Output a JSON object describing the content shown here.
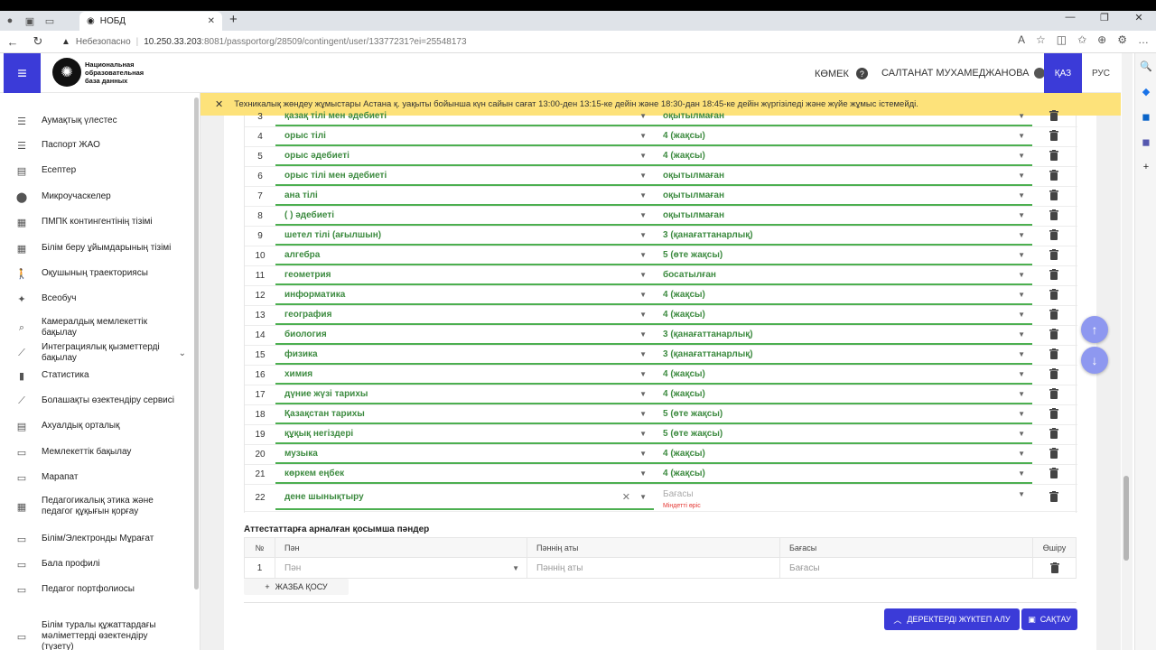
{
  "browser": {
    "tab_title": "НОБД",
    "insecure_label": "Небезопасно",
    "url_host": "10.250.33.203",
    "url_rest": ":8081/passportorg/28509/contingent/user/13377231?ei=25548173"
  },
  "header": {
    "logo_text": "Национальная образовательная база данных",
    "help_label": "КӨМЕК",
    "user_name": "САЛТАНАТ МУХАМЕДЖАНОВА",
    "lang_kz": "ҚАЗ",
    "lang_ru": "РУС"
  },
  "notice": {
    "text": "Техникалық жөндеу жұмыстары Астана қ. уақыты бойынша күн сайын сағат 13:00-ден 13:15-ке дейін және 18:30-дан 18:45-ке дейін жүргізіледі және жүйе жұмыс істемейді."
  },
  "sidebar": {
    "items": [
      {
        "label": "Аумақтық үлестес",
        "icon": "list-icon"
      },
      {
        "label": "Паспорт ЖАО",
        "icon": "list-icon"
      },
      {
        "label": "Есептер",
        "icon": "clipboard-icon"
      },
      {
        "label": "Микроучаскелер",
        "icon": "pin-icon"
      },
      {
        "label": "ПМПК контингентінің тізімі",
        "icon": "table-icon"
      },
      {
        "label": "Білім беру ұйымдарының тізімі",
        "icon": "table-icon"
      },
      {
        "label": "Оқушының траекториясы",
        "icon": "walk-icon"
      },
      {
        "label": "Всеобуч",
        "icon": "person-icon"
      },
      {
        "label": "Камералдық мемлекеттік бақылау",
        "icon": "search-doc-icon"
      },
      {
        "label": "Интеграциялық қызметтерді бақылау",
        "icon": "trend-icon"
      },
      {
        "label": "Статистика",
        "icon": "bar-chart-icon"
      },
      {
        "label": "Болашақты өзектендіру сервисі",
        "icon": "trend-icon"
      },
      {
        "label": "Ахуалдық орталық",
        "icon": "clipboard-icon"
      },
      {
        "label": "Мемлекеттік бақылау",
        "icon": "window-icon"
      },
      {
        "label": "Марапат",
        "icon": "window-icon"
      },
      {
        "label": "Педагогикалық этика және педагог құқығын қорғау",
        "icon": "table-icon"
      },
      {
        "label": "Білім/Электронды Мұрағат",
        "icon": "window-icon"
      },
      {
        "label": "Бала профилі",
        "icon": "window-icon"
      },
      {
        "label": "Педагог портфолиосы",
        "icon": "window-icon"
      },
      {
        "label": "Білім туралы құжаттардағы мәліметтерді өзектендіру (түзету)",
        "icon": "window-icon"
      }
    ]
  },
  "grades_table": {
    "rows": [
      {
        "n": "3",
        "subject": "қазақ тілі мен әдебиеті",
        "grade": "оқытылмаған"
      },
      {
        "n": "4",
        "subject": "орыс тілі",
        "grade": "4 (жақсы)"
      },
      {
        "n": "5",
        "subject": "орыс әдебиеті",
        "grade": "4 (жақсы)"
      },
      {
        "n": "6",
        "subject": "орыс тілі мен әдебиеті",
        "grade": "оқытылмаған"
      },
      {
        "n": "7",
        "subject": "ана тілі",
        "grade": "оқытылмаған"
      },
      {
        "n": "8",
        "subject": "( ) әдебиеті",
        "grade": "оқытылмаған"
      },
      {
        "n": "9",
        "subject": "шетел тілі (ағылшын)",
        "grade": "3 (қанағаттанарлық)"
      },
      {
        "n": "10",
        "subject": "алгебра",
        "grade": "5 (өте жақсы)"
      },
      {
        "n": "11",
        "subject": "геометрия",
        "grade": "босатылған"
      },
      {
        "n": "12",
        "subject": "информатика",
        "grade": "4 (жақсы)"
      },
      {
        "n": "13",
        "subject": "география",
        "grade": "4 (жақсы)"
      },
      {
        "n": "14",
        "subject": "биология",
        "grade": "3 (қанағаттанарлық)"
      },
      {
        "n": "15",
        "subject": "физика",
        "grade": "3 (қанағаттанарлық)"
      },
      {
        "n": "16",
        "subject": "химия",
        "grade": "4 (жақсы)"
      },
      {
        "n": "17",
        "subject": "дүние жүзі тарихы",
        "grade": "4 (жақсы)"
      },
      {
        "n": "18",
        "subject": "Қазақстан тарихы",
        "grade": "5 (өте жақсы)"
      },
      {
        "n": "19",
        "subject": "құқық негіздері",
        "grade": "5 (өте жақсы)"
      },
      {
        "n": "20",
        "subject": "музыка",
        "grade": "4 (жақсы)"
      },
      {
        "n": "21",
        "subject": "көркем еңбек",
        "grade": "4 (жақсы)"
      }
    ],
    "last_row": {
      "n": "22",
      "subject": "дене шынықтыру",
      "grade_placeholder": "Бағасы",
      "required_msg": "Міндетті өріс"
    }
  },
  "extra_section": {
    "title": "Аттестаттарға арналған қосымша пәндер",
    "headers": {
      "n": "№",
      "subject": "Пән",
      "subject_name": "Пәннің аты",
      "grade": "Бағасы",
      "delete": "Өшіру"
    },
    "row": {
      "n": "1",
      "subject_placeholder": "Пән",
      "subject_name_placeholder": "Пәннің аты",
      "grade_placeholder": "Бағасы"
    },
    "add_label": "ЖАЗБА ҚОСУ"
  },
  "actions": {
    "load_label": "ДЕРЕКТЕРДІ ЖҮКТЕП АЛУ",
    "save_label": "САҚТАУ"
  },
  "colors": {
    "primary": "#3b3bd8",
    "success_green": "#4caf50",
    "notice_yellow": "#fde27a",
    "error_red": "#e53935"
  }
}
